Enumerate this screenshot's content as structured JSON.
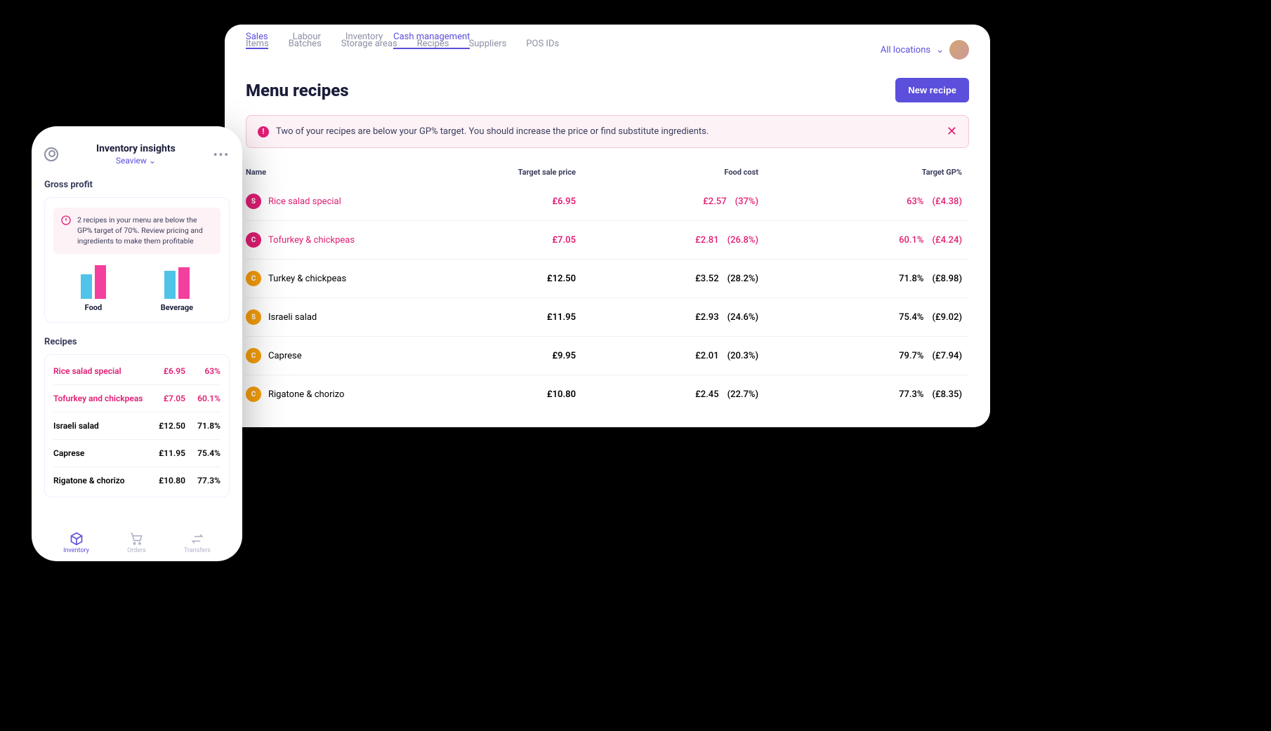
{
  "desktop": {
    "tabs_primary": [
      "Items",
      "Batches",
      "Storage areas",
      "Recipes",
      "Suppliers",
      "POS IDs"
    ],
    "tabs_secondary": [
      "Sales",
      "Labour",
      "Inventory",
      "Cash management"
    ],
    "location_label": "All locations",
    "page_title": "Menu recipes",
    "new_button": "New recipe",
    "alert_text": "Two of your recipes are below your GP% target. You should increase the price or find substitute ingredients.",
    "columns": {
      "name": "Name",
      "price": "Target sale price",
      "cost": "Food cost",
      "gp": "Target GP%"
    },
    "rows": [
      {
        "badge": "S",
        "badge_color": "pink",
        "name": "Rice salad special",
        "price": "£6.95",
        "cost": "£2.57",
        "cost_pct": "(37%)",
        "gp": "63%",
        "gp_val": "(£4.38)",
        "warn": true
      },
      {
        "badge": "C",
        "badge_color": "pink",
        "name": "Tofurkey & chickpeas",
        "price": "£7.05",
        "cost": "£2.81",
        "cost_pct": "(26.8%)",
        "gp": "60.1%",
        "gp_val": "(£4.24)",
        "warn": true
      },
      {
        "badge": "C",
        "badge_color": "orange",
        "name": "Turkey & chickpeas",
        "price": "£12.50",
        "cost": "£3.52",
        "cost_pct": "(28.2%)",
        "gp": "71.8%",
        "gp_val": "(£8.98)",
        "warn": false
      },
      {
        "badge": "S",
        "badge_color": "orange",
        "name": "Israeli salad",
        "price": "£11.95",
        "cost": "£2.93",
        "cost_pct": "(24.6%)",
        "gp": "75.4%",
        "gp_val": "(£9.02)",
        "warn": false
      },
      {
        "badge": "C",
        "badge_color": "orange",
        "name": "Caprese",
        "price": "£9.95",
        "cost": "£2.01",
        "cost_pct": "(20.3%)",
        "gp": "79.7%",
        "gp_val": "(£7.94)",
        "warn": false
      },
      {
        "badge": "C",
        "badge_color": "orange",
        "name": "Rigatone & chorizo",
        "price": "£10.80",
        "cost": "£2.45",
        "cost_pct": "(22.7%)",
        "gp": "77.3%",
        "gp_val": "(£8.35)",
        "warn": false
      }
    ]
  },
  "mobile": {
    "title": "Inventory insights",
    "location": "Seaview",
    "section_gp": "Gross profit",
    "alert_text": "2 recipes in your menu are below the GP% target of 70%. Review pricing and ingredients to make them profitable",
    "bar_labels": {
      "food": "Food",
      "beverage": "Beverage"
    },
    "section_recipes": "Recipes",
    "rows": [
      {
        "name": "Rice salad special",
        "price": "£6.95",
        "gp": "63%",
        "warn": true
      },
      {
        "name": "Tofurkey and chickpeas",
        "price": "£7.05",
        "gp": "60.1%",
        "warn": true
      },
      {
        "name": "Israeli salad",
        "price": "£12.50",
        "gp": "71.8%",
        "warn": false
      },
      {
        "name": "Caprese",
        "price": "£11.95",
        "gp": "75.4%",
        "warn": false
      },
      {
        "name": "Rigatone & chorizo",
        "price": "£10.80",
        "gp": "77.3%",
        "warn": false
      }
    ],
    "nav": {
      "inventory": "Inventory",
      "orders": "Orders",
      "transfers": "Transfers"
    }
  },
  "chart_data": {
    "type": "bar",
    "series": [
      {
        "name": "blue",
        "values": [
          35,
          40
        ]
      },
      {
        "name": "pink",
        "values": [
          48,
          45
        ]
      }
    ],
    "categories": [
      "Food",
      "Beverage"
    ]
  }
}
